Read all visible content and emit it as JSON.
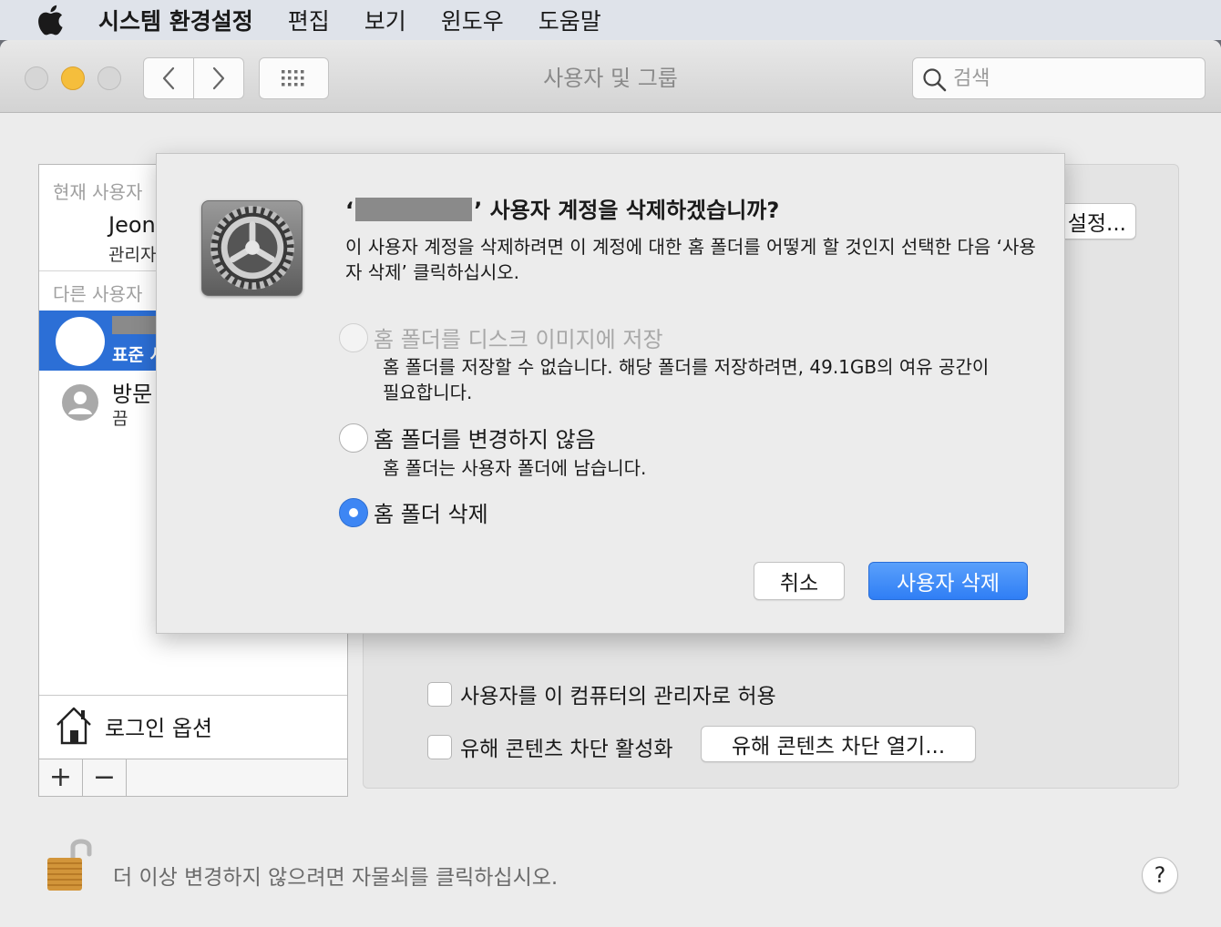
{
  "menubar": {
    "app_name": "시스템 환경설정",
    "items": [
      "편집",
      "보기",
      "윈도우",
      "도움말"
    ]
  },
  "window": {
    "title": "사용자 및 그룹",
    "search_placeholder": "검색"
  },
  "sidebar": {
    "current_header": "현재 사용자",
    "current_user_name": "Jeon",
    "current_user_role": "관리자",
    "other_header": "다른 사용자",
    "selected_user_role": "표준 사",
    "guest_name": "방문",
    "guest_status": "끔",
    "login_options": "로그인 옵션",
    "add_label": "+",
    "remove_label": "−"
  },
  "main": {
    "settings_button_partial": "설정...",
    "allow_admin_label": "사용자를 이 컴퓨터의 관리자로 허용",
    "parental_label": "유해 콘텐츠 차단 활성화",
    "parental_button": "유해 콘텐츠 차단 열기..."
  },
  "footer": {
    "lock_text": "더 이상 변경하지 않으려면 자물쇠를 클릭하십시오.",
    "help_label": "?"
  },
  "dialog": {
    "title_open_quote": "‘",
    "title_rest": "’ 사용자 계정을 삭제하겠습니까?",
    "description": "이 사용자 계정을 삭제하려면 이 계정에 대한 홈 폴더를 어떻게 할 것인지 선택한 다음 ‘사용자 삭제’ 클릭하십시오.",
    "options": [
      {
        "label": "홈 폴더를 디스크 이미지에 저장",
        "sub": "홈 폴더를 저장할 수 없습니다. 해당 폴더를 저장하려면, 49.1GB의 여유 공간이 필요합니다.",
        "state": "disabled"
      },
      {
        "label": "홈 폴더를 변경하지 않음",
        "sub": "홈 폴더는 사용자 폴더에 남습니다.",
        "state": "unselected"
      },
      {
        "label": "홈 폴더 삭제",
        "sub": "",
        "state": "selected"
      }
    ],
    "cancel_button": "취소",
    "delete_button": "사용자 삭제"
  },
  "colors": {
    "selection_blue": "#2c6fd6",
    "primary_button": "#3d86f4",
    "minimize_yellow": "#f5be3c"
  }
}
